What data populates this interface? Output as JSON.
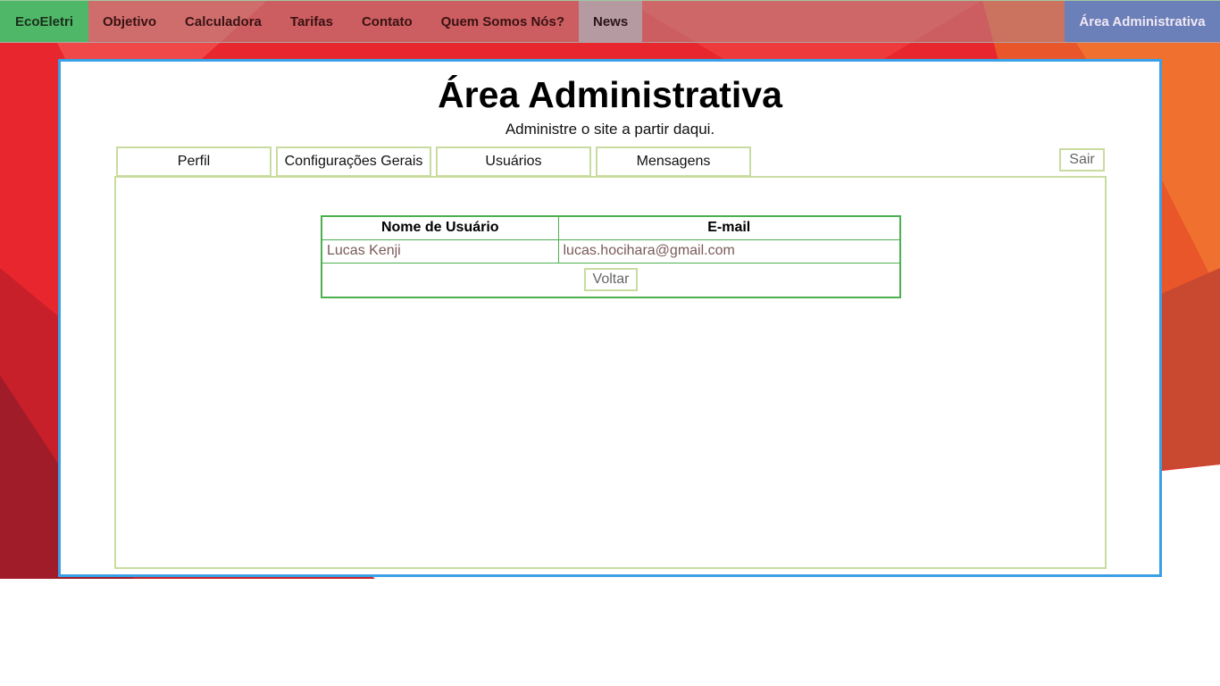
{
  "nav": {
    "brand": "EcoEletri",
    "items": [
      "Objetivo",
      "Calculadora",
      "Tarifas",
      "Contato",
      "Quem Somos Nós?",
      "News"
    ],
    "admin": "Área Administrativa"
  },
  "page": {
    "title": "Área Administrativa",
    "subtitle": "Administre o site a partir daqui."
  },
  "tabs": [
    "Perfil",
    "Configurações Gerais",
    "Usuários",
    "Mensagens"
  ],
  "logout_label": "Sair",
  "table": {
    "headers": [
      "Nome de Usuário",
      "E-mail"
    ],
    "rows": [
      [
        "Lucas Kenji",
        "lucas.hocihara@gmail.com"
      ]
    ],
    "back_label": "Voltar"
  },
  "colors": {
    "brand": "#4fb868",
    "admin_tab": "#6b7fb8",
    "panel_border": "#3aa0e6",
    "table_border": "#4caf50",
    "tab_border": "#c9dca0"
  }
}
